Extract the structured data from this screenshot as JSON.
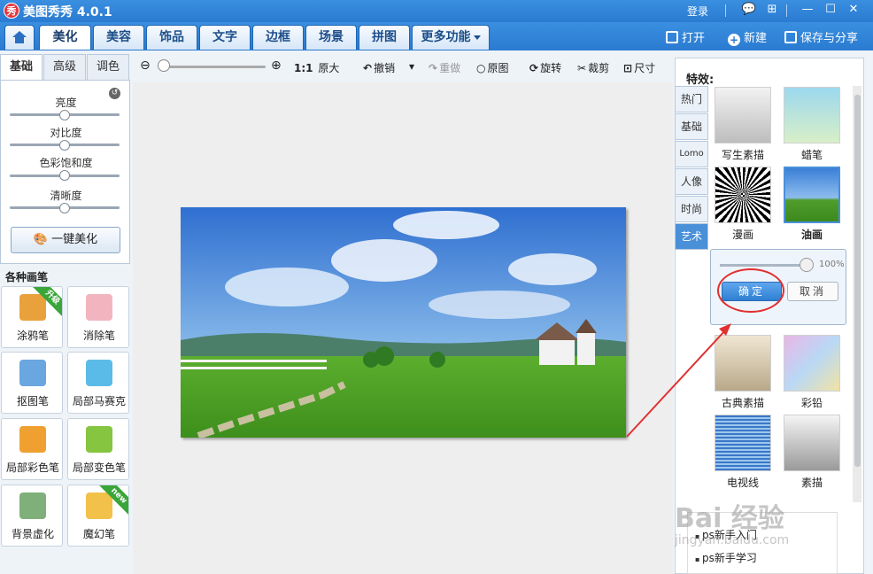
{
  "app": {
    "logo_glyph": "秀",
    "title": "美图秀秀 4.0.1",
    "login": "登录",
    "win_buttons": {
      "chat": "💬",
      "menu": "⊞",
      "minimize": "—",
      "maximize": "☐",
      "close": "✕"
    }
  },
  "tabs": [
    {
      "label": "美化",
      "active": true
    },
    {
      "label": "美容"
    },
    {
      "label": "饰品"
    },
    {
      "label": "文字"
    },
    {
      "label": "边框"
    },
    {
      "label": "场景"
    },
    {
      "label": "拼图"
    },
    {
      "label": "更多功能"
    }
  ],
  "top_actions": {
    "open": "打开",
    "new": "新建",
    "save_share": "保存与分享"
  },
  "toolbar": {
    "zoom_ratio": "1:1",
    "original_size": "原大",
    "undo": "撤销",
    "redo": "重做",
    "original": "原图",
    "rotate": "旋转",
    "crop": "裁剪",
    "resize": "尺寸"
  },
  "left_panel": {
    "subtabs": [
      {
        "label": "基础",
        "active": true
      },
      {
        "label": "高级"
      },
      {
        "label": "调色"
      }
    ],
    "adjustments": [
      {
        "label": "亮度",
        "value_pct": 50
      },
      {
        "label": "对比度",
        "value_pct": 50
      },
      {
        "label": "色彩饱和度",
        "value_pct": 50
      },
      {
        "label": "清晰度",
        "value_pct": 50
      }
    ],
    "one_click": "一键美化",
    "brush_section_title": "各种画笔",
    "brushes": [
      {
        "label": "涂鸦笔",
        "badge": "升级",
        "color": "#e9a23b"
      },
      {
        "label": "消除笔",
        "badge": "",
        "color": "#f2b5c0"
      },
      {
        "label": "抠图笔",
        "badge": "",
        "color": "#6aa6e0"
      },
      {
        "label": "局部马赛克",
        "badge": "",
        "color": "#5bbbe8"
      },
      {
        "label": "局部彩色笔",
        "badge": "",
        "color": "#f0a030"
      },
      {
        "label": "局部变色笔",
        "badge": "",
        "color": "#86c540"
      },
      {
        "label": "背景虚化",
        "badge": "",
        "color": "#7fb07a"
      },
      {
        "label": "魔幻笔",
        "badge": "new",
        "color": "#f2c14a"
      }
    ]
  },
  "right_panel": {
    "title": "特效:",
    "categories": [
      {
        "label": "热门"
      },
      {
        "label": "基础"
      },
      {
        "label": "Lomo"
      },
      {
        "label": "人像"
      },
      {
        "label": "时尚"
      },
      {
        "label": "艺术",
        "active": true
      }
    ],
    "effects": [
      {
        "label": "写生素描"
      },
      {
        "label": "蜡笔"
      },
      {
        "label": "漫画"
      },
      {
        "label": "油画",
        "selected": true
      },
      {
        "label": "古典素描"
      },
      {
        "label": "彩铅"
      },
      {
        "label": "电视线"
      },
      {
        "label": "素描"
      }
    ],
    "popup": {
      "strength_pct": 100,
      "strength_text": "100%",
      "ok": "确定",
      "cancel": "取消"
    }
  },
  "links": [
    "ps新手入门",
    "ps新手学习"
  ],
  "watermark": {
    "main": "Bai 经验",
    "sub": "jingyan.baidu.com"
  },
  "colors": {
    "titlebar": "#2a7bd1",
    "accent": "#4a90d9",
    "annotation": "#e03030"
  }
}
